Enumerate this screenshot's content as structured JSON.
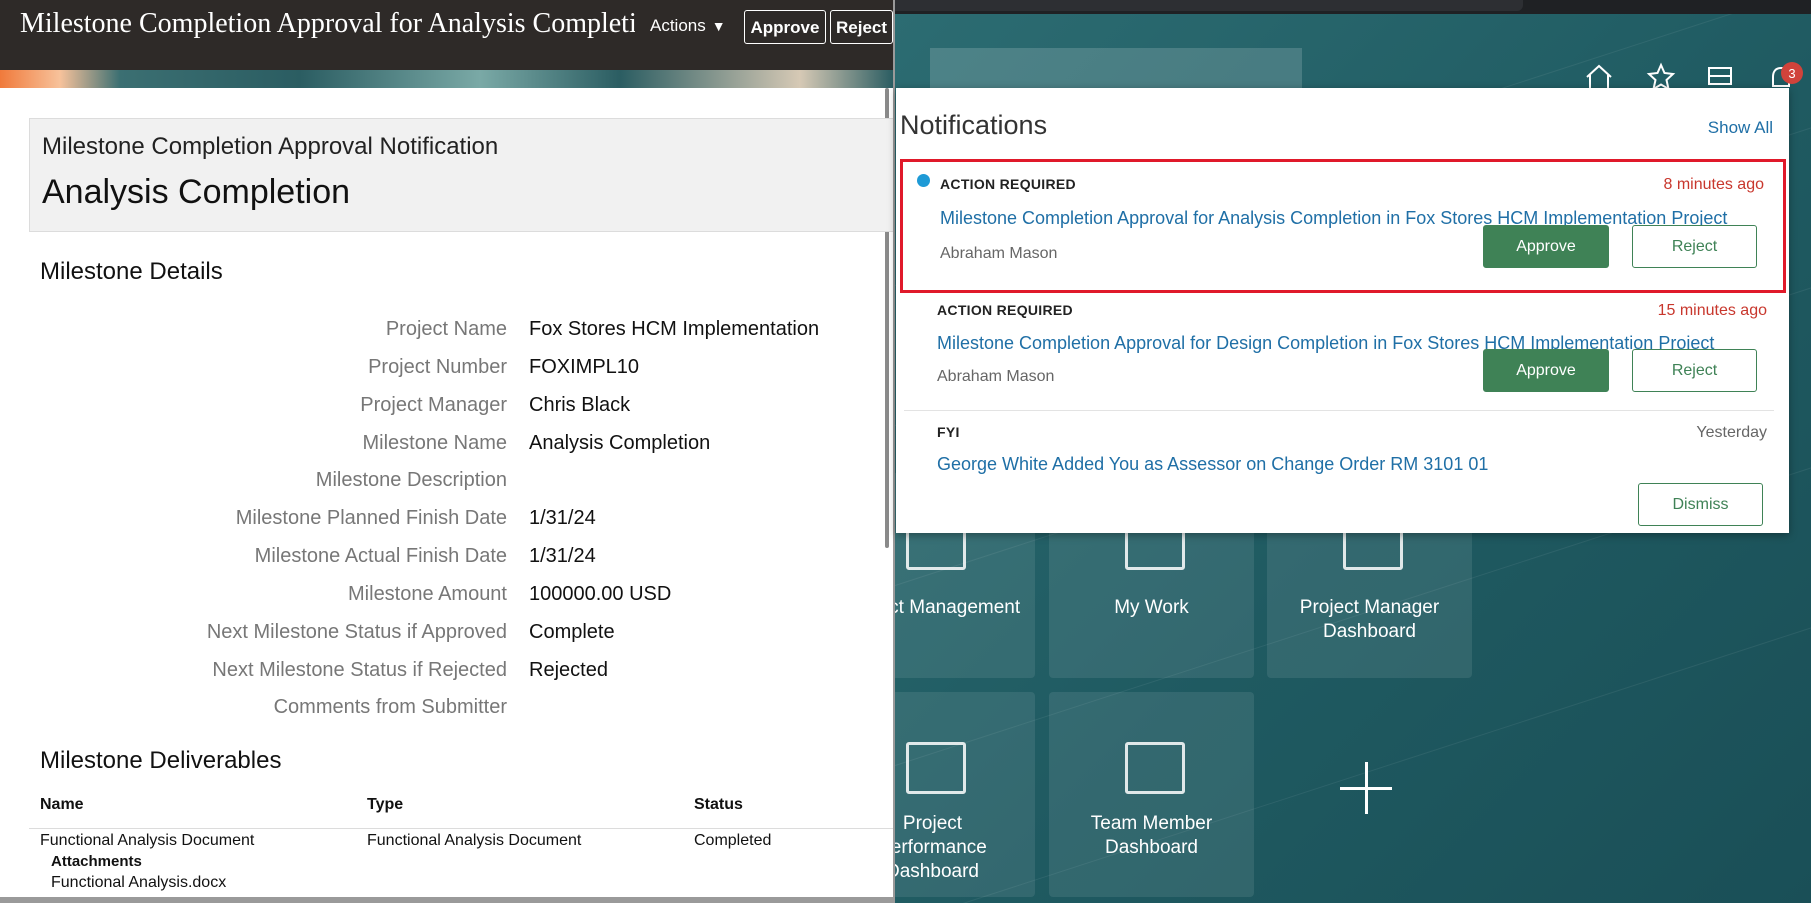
{
  "colors": {
    "topbar_bg": "#2e2a28",
    "approve_green": "#3f8256",
    "link_blue": "#1f6fa6",
    "time_red": "#c8372d",
    "highlight_red": "#e0192a",
    "unread_dot": "#1e9ad6"
  },
  "left_panel": {
    "topbar": {
      "title": "Milestone Completion Approval for Analysis Completion in Fox Stores HCM Implementation Project",
      "actions_label": "Actions",
      "approve_label": "Approve",
      "reject_label": "Reject"
    },
    "header": {
      "subtitle": "Milestone Completion Approval Notification",
      "title": "Analysis Completion"
    },
    "details": {
      "section_title": "Milestone Details",
      "fields": [
        {
          "label": "Project Name",
          "value": "Fox Stores HCM Implementation"
        },
        {
          "label": "Project Number",
          "value": "FOXIMPL10"
        },
        {
          "label": "Project Manager",
          "value": "Chris Black"
        },
        {
          "label": "Milestone Name",
          "value": "Analysis Completion"
        },
        {
          "label": "Milestone Description",
          "value": ""
        },
        {
          "label": "Milestone Planned Finish Date",
          "value": "1/31/24"
        },
        {
          "label": "Milestone Actual Finish Date",
          "value": "1/31/24"
        },
        {
          "label": "Milestone Amount",
          "value": "100000.00 USD"
        },
        {
          "label": "Next Milestone Status if Approved",
          "value": "Complete"
        },
        {
          "label": "Next Milestone Status if Rejected",
          "value": "Rejected"
        },
        {
          "label": "Comments from Submitter",
          "value": ""
        }
      ]
    },
    "deliverables": {
      "section_title": "Milestone Deliverables",
      "columns": [
        "Name",
        "Type",
        "Status"
      ],
      "rows": [
        {
          "name": "Functional Analysis Document",
          "type": "Functional Analysis Document",
          "status": "Completed"
        }
      ],
      "attachments_label": "Attachments",
      "attachment_file": "Functional Analysis.docx"
    }
  },
  "notifications": {
    "title": "Notifications",
    "show_all": "Show All",
    "items": [
      {
        "type": "ACTION REQUIRED",
        "time": "8 minutes ago",
        "link": "Milestone Completion Approval for Analysis Completion in Fox Stores HCM Implementation Project",
        "from": "Abraham Mason",
        "approve": "Approve",
        "reject": "Reject"
      },
      {
        "type": "ACTION REQUIRED",
        "time": "15 minutes ago",
        "link": "Milestone Completion Approval for Design Completion in Fox Stores HCM Implementation Project",
        "from": "Abraham Mason",
        "approve": "Approve",
        "reject": "Reject"
      },
      {
        "type": "FYI",
        "time": "Yesterday",
        "link": "George White Added You as Assessor on Change Order RM 3101 01",
        "dismiss": "Dismiss"
      }
    ]
  },
  "home": {
    "bell_badge": "3",
    "tiles": [
      {
        "label": "Project Management",
        "icon": "document-icon"
      },
      {
        "label": "My Work",
        "icon": "checklist-icon"
      },
      {
        "label": "Project Manager Dashboard",
        "icon": "dashboard-icon"
      },
      {
        "label": "Project Performance Dashboard",
        "icon": "dashboard-icon"
      },
      {
        "label": "Team Member Dashboard",
        "icon": "dashboard-icon"
      }
    ],
    "add_tile_icon": "plus-icon"
  }
}
